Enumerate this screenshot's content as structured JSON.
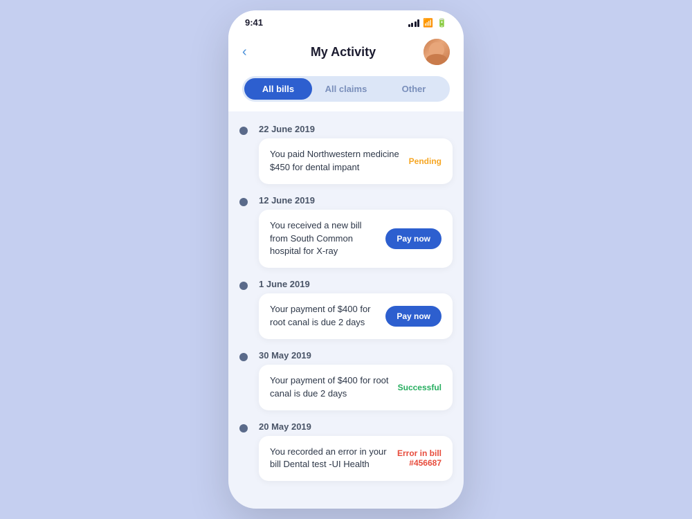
{
  "statusBar": {
    "time": "9:41"
  },
  "header": {
    "title": "My Activity",
    "backLabel": "‹"
  },
  "tabs": [
    {
      "label": "All bills",
      "active": true
    },
    {
      "label": "All claims",
      "active": false
    },
    {
      "label": "Other",
      "active": false
    }
  ],
  "timeline": [
    {
      "date": "22 June 2019",
      "card": {
        "text": "You paid Northwestern medicine $450 for dental impant",
        "badgeType": "pending",
        "badgeText": "Pending",
        "hasButton": false
      }
    },
    {
      "date": "12 June 2019",
      "card": {
        "text": "You received a new bill from South Common hospital for X-ray",
        "badgeType": "button",
        "badgeText": "Pay now",
        "hasButton": true
      }
    },
    {
      "date": "1 June 2019",
      "card": {
        "text": "Your payment of $400 for root canal is due 2 days",
        "badgeType": "button",
        "badgeText": "Pay now",
        "hasButton": true
      }
    },
    {
      "date": "30 May 2019",
      "card": {
        "text": "Your payment of $400 for root canal is due 2 days",
        "badgeType": "success",
        "badgeText": "Successful",
        "hasButton": false
      }
    },
    {
      "date": "20 May 2019",
      "card": {
        "text": "You recorded an error in your bill Dental test -UI Health",
        "badgeType": "error",
        "badgeText": "Error in bill\n#456687",
        "hasButton": false
      }
    }
  ]
}
